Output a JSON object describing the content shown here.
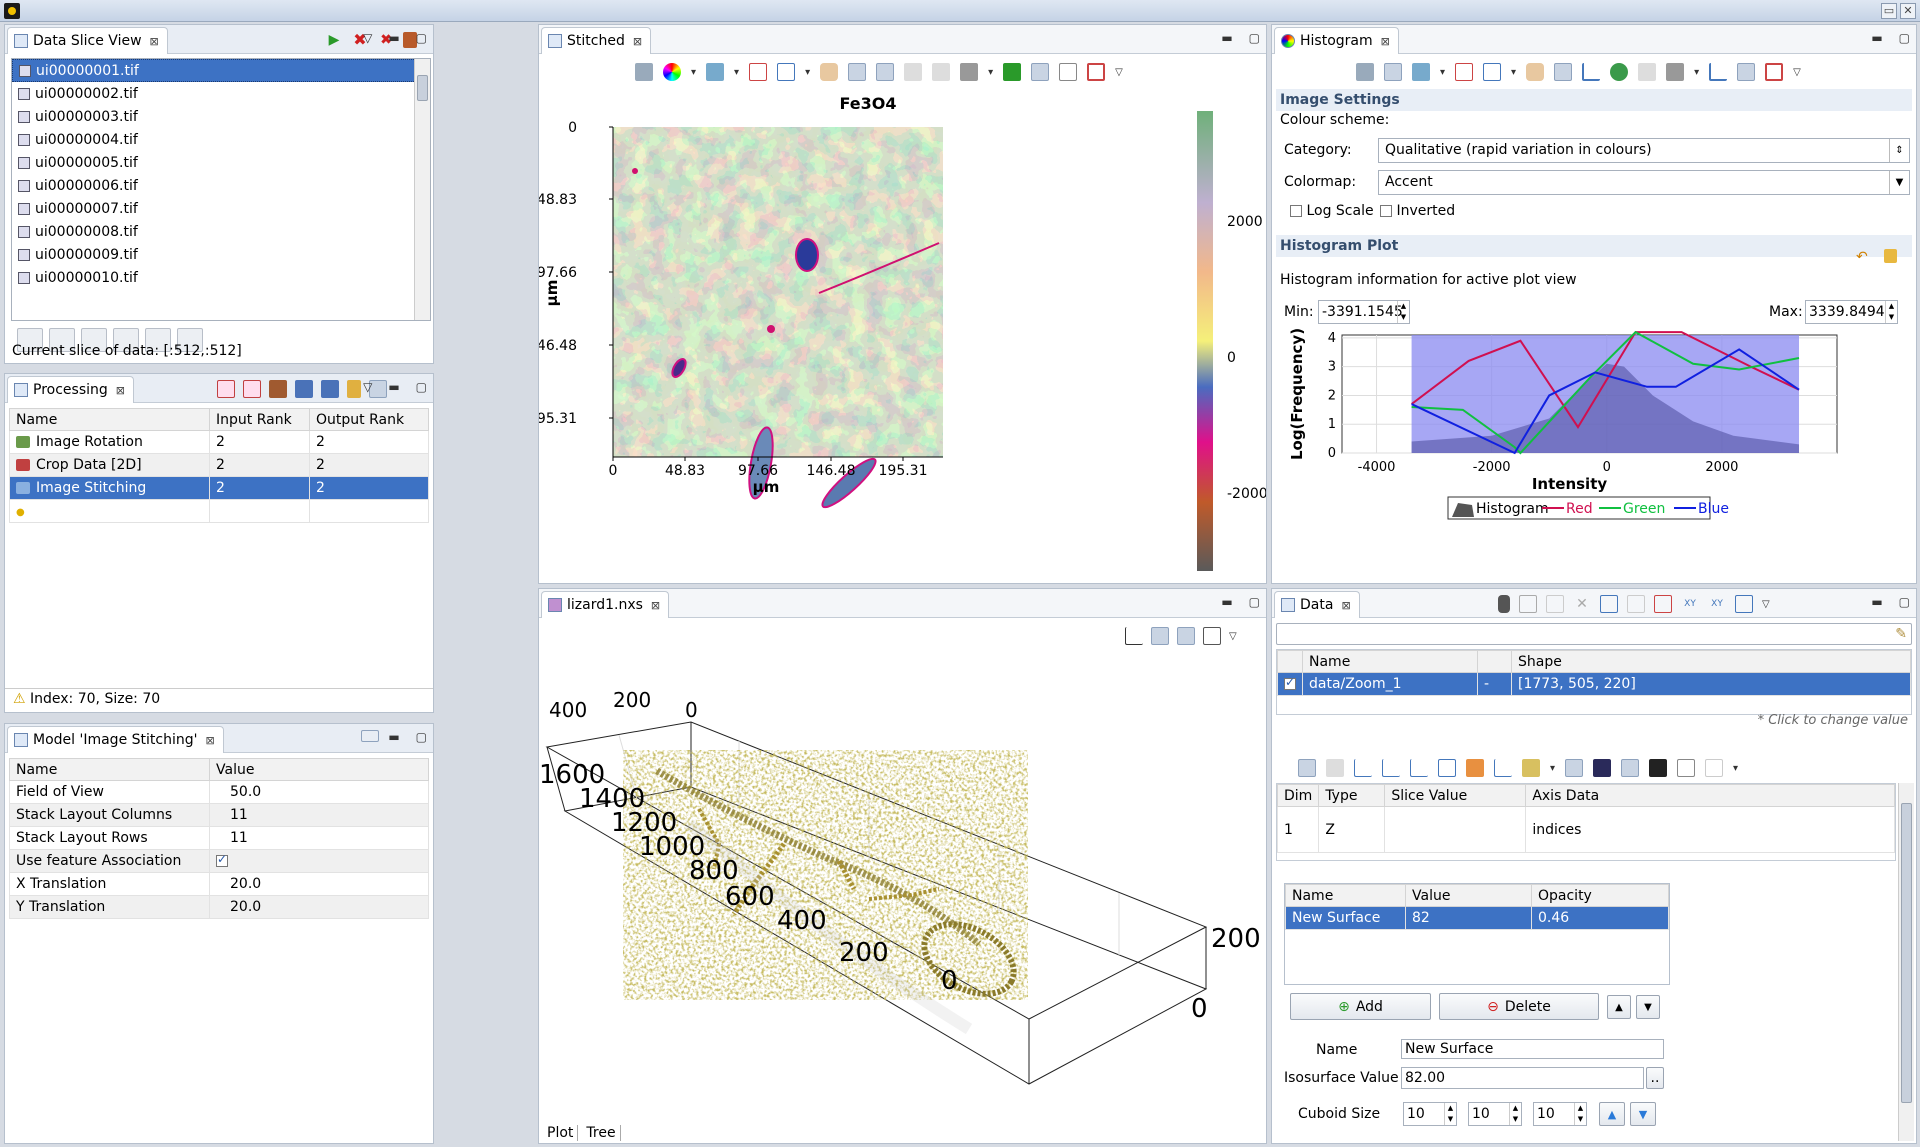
{
  "slice_view": {
    "tab": "Data Slice View",
    "files": [
      "ui00000001.tif",
      "ui00000002.tif",
      "ui00000003.tif",
      "ui00000004.tif",
      "ui00000005.tif",
      "ui00000006.tif",
      "ui00000007.tif",
      "ui00000008.tif",
      "ui00000009.tif",
      "ui00000010.tif"
    ],
    "current_slice": "Current slice of data: [:512,:512]"
  },
  "processing": {
    "tab": "Processing",
    "columns": [
      "Name",
      "Input Rank",
      "Output Rank"
    ],
    "rows": [
      {
        "name": "Image Rotation",
        "input": "2",
        "output": "2"
      },
      {
        "name": "Crop Data [2D]",
        "input": "2",
        "output": "2"
      },
      {
        "name": "Image Stitching",
        "input": "2",
        "output": "2"
      }
    ],
    "status": "Index: 70, Size: 70"
  },
  "model": {
    "tab": "Model 'Image Stitching'",
    "columns": [
      "Name",
      "Value"
    ],
    "rows": [
      {
        "name": "Field of View",
        "value": "50.0"
      },
      {
        "name": "Stack Layout Columns",
        "value": "11"
      },
      {
        "name": "Stack Layout Rows",
        "value": "11"
      },
      {
        "name": "Use feature Association",
        "value": ""
      },
      {
        "name": "X Translation",
        "value": "20.0"
      },
      {
        "name": "Y Translation",
        "value": "20.0"
      }
    ]
  },
  "stitched": {
    "tab": "Stitched",
    "title": "Fe3O4",
    "ylabel": "µm",
    "xlabel": "µm",
    "yticks": [
      "0",
      "48.83",
      "97.66",
      "146.48",
      "195.31"
    ],
    "xticks": [
      "0",
      "48.83",
      "97.66",
      "146.48",
      "195.31"
    ],
    "cbar_ticks": [
      "2000",
      "0",
      "-2000"
    ]
  },
  "histogram": {
    "tab": "Histogram",
    "image_settings": "Image Settings",
    "colour_scheme": "Colour scheme:",
    "category_label": "Category:",
    "category_value": "Qualitative (rapid variation in colours)",
    "colormap_label": "Colormap:",
    "colormap_value": "Accent",
    "log_scale": "Log Scale",
    "inverted": "Inverted",
    "plot_head": "Histogram Plot",
    "info": "Histogram information for active plot view",
    "min_label": "Min:",
    "min_value": "-3391.1545",
    "max_label": "Max:",
    "max_value": "3339.8494",
    "chart_data": {
      "type": "line",
      "xlabel": "Intensity",
      "ylabel": "Log(Frequency)",
      "xlim": [
        -4600,
        4000
      ],
      "ylim": [
        0,
        4.1
      ],
      "xticks": [
        "-4000",
        "-2000",
        "0",
        "2000"
      ],
      "yticks": [
        "0",
        "1",
        "2",
        "3",
        "4"
      ],
      "selection": [
        -3391.1545,
        3339.8494
      ],
      "legend": [
        "Histogram",
        "Red",
        "Green",
        "Blue"
      ],
      "series": [
        {
          "name": "Red",
          "color": "#d01050",
          "x": [
            -3391,
            -2400,
            -1500,
            -500,
            500,
            1300,
            2500,
            3340
          ],
          "y": [
            1.7,
            3.2,
            3.9,
            0.9,
            4.2,
            4.2,
            3.0,
            2.2
          ]
        },
        {
          "name": "Green",
          "color": "#10c040",
          "x": [
            -3391,
            -2500,
            -1600,
            -1500,
            -300,
            500,
            1500,
            2300,
            3340
          ],
          "y": [
            1.6,
            1.5,
            0.2,
            0.0,
            2.6,
            4.2,
            3.1,
            2.9,
            3.3
          ]
        },
        {
          "name": "Blue",
          "color": "#1020e0",
          "x": [
            -3391,
            -1600,
            -1000,
            -200,
            700,
            1200,
            2300,
            3340
          ],
          "y": [
            1.7,
            0.0,
            2.0,
            2.8,
            2.3,
            2.3,
            3.6,
            2.2
          ]
        }
      ],
      "hist_envelope": {
        "x": [
          -3391,
          -2000,
          -1000,
          -500,
          0,
          300,
          800,
          1500,
          2200,
          3340
        ],
        "y": [
          0.4,
          0.6,
          1.2,
          2.2,
          3.1,
          3.0,
          2.0,
          1.1,
          0.6,
          0.3
        ]
      }
    }
  },
  "lizard": {
    "tab": "lizard1.nxs",
    "axis_left": [
      "1600",
      "1400",
      "1200",
      "1000",
      "800",
      "600",
      "400",
      "200",
      "0"
    ],
    "axis_top": [
      "400",
      "200",
      "0"
    ],
    "axis_right": [
      "200",
      "0"
    ],
    "bottom_tabs": [
      "Plot",
      "Tree"
    ]
  },
  "data": {
    "tab": "Data",
    "columns": [
      "Name",
      "Shape"
    ],
    "row_name": "data/Zoom_1",
    "row_dash": "-",
    "row_shape": "[1773, 505, 220]",
    "click_hint": "* Click to change value",
    "dim_columns": [
      "Dim",
      "Type",
      "Slice Value",
      "Axis Data"
    ],
    "dim_row": {
      "dim": "1",
      "type": "Z",
      "slice": "",
      "axis": "indices"
    },
    "surface_columns": [
      "Name",
      "Value",
      "Opacity"
    ],
    "surface_row": {
      "name": "New Surface",
      "value": "82",
      "opacity": "0.46"
    },
    "add": "Add",
    "delete": "Delete",
    "name_label": "Name",
    "name_value": "New Surface",
    "iso_label": "Isosurface Value",
    "iso_value": "82.00",
    "more": "..",
    "cuboid_label": "Cuboid Size",
    "cuboid": [
      "10",
      "10",
      "10"
    ]
  }
}
